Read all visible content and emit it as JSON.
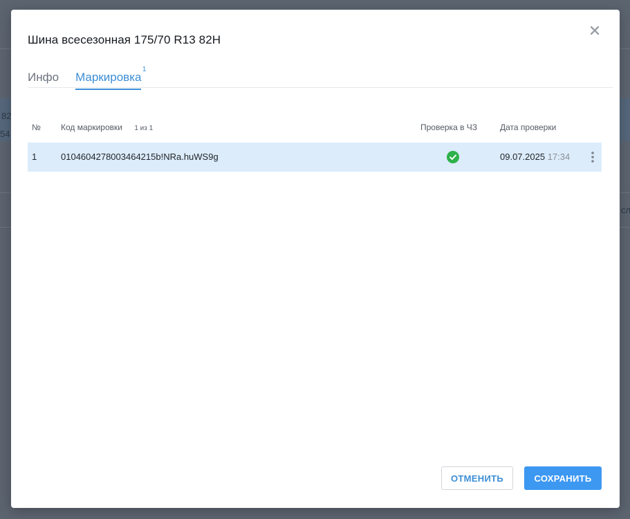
{
  "background": {
    "fragments": [
      "82",
      "54",
      "сл"
    ]
  },
  "modal": {
    "title": "Шина всесезонная 175/70 R13 82H",
    "tabs": [
      {
        "label": "Инфо",
        "active": false
      },
      {
        "label": "Маркировка",
        "active": true,
        "badge": "1"
      }
    ]
  },
  "table": {
    "headers": {
      "number": "№",
      "code": "Код маркировки",
      "count": "1 из 1",
      "check": "Проверка в ЧЗ",
      "date": "Дата проверки"
    },
    "rows": [
      {
        "number": "1",
        "code": "0104604278003464215b!NRa.huWS9g",
        "check_status": "verified",
        "date": "09.07.2025",
        "time": "17:34"
      }
    ]
  },
  "buttons": {
    "cancel": "ОТМЕНИТЬ",
    "save": "СОХРАНИТЬ"
  },
  "colors": {
    "accent": "#3b8ed6",
    "save_button": "#3d98f2",
    "selected_row": "#dcecfb",
    "verified": "#2db14a"
  },
  "icons": {
    "close": "close-icon",
    "status": "check-circle-icon",
    "row_menu": "kebab-menu-icon"
  }
}
